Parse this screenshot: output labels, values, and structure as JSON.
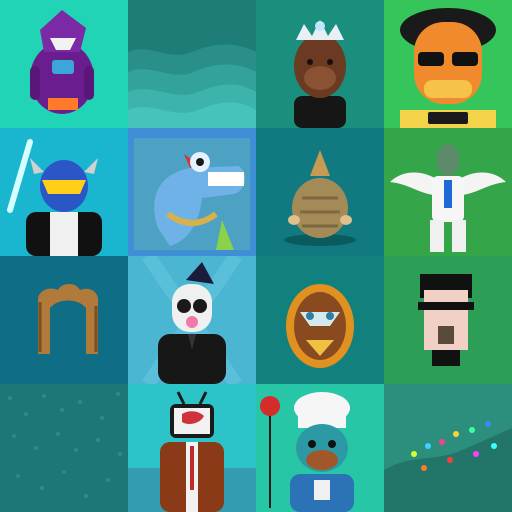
{
  "grid": {
    "columns": 4,
    "rows": 4,
    "tiles": [
      {
        "subject": "purple-shark-monster-icon",
        "bg": "#22d4b6"
      },
      {
        "subject": "teal-waves-icon",
        "bg": "#1f7d78"
      },
      {
        "subject": "ape-with-crown-icon",
        "bg": "#1b8f7d"
      },
      {
        "subject": "orange-cartoon-face-icon",
        "bg": "#35c55a"
      },
      {
        "subject": "blue-robot-samurai-icon",
        "bg": "#1ab6d0"
      },
      {
        "subject": "dinosaur-with-chain-icon",
        "bg": "#3f8fd6"
      },
      {
        "subject": "armadillo-creature-icon",
        "bg": "#107a80"
      },
      {
        "subject": "winged-white-suit-man-icon",
        "bg": "#35a54a"
      },
      {
        "subject": "bronze-arch-gate-icon",
        "bg": "#0f6e86"
      },
      {
        "subject": "skull-wizard-suit-icon",
        "bg": "#4ab6d2"
      },
      {
        "subject": "ornate-mask-medallion-icon",
        "bg": "#12807c"
      },
      {
        "subject": "pixel-sunglasses-man-icon",
        "bg": "#2c9e55"
      },
      {
        "subject": "teal-texture-icon",
        "bg": "#1d7777"
      },
      {
        "subject": "tv-head-businessman-icon",
        "bg": "#2cc4c9"
      },
      {
        "subject": "chef-dog-balloon-icon",
        "bg": "#27c6a6"
      },
      {
        "subject": "colorful-particles-icon",
        "bg": "#2c8f7e"
      }
    ]
  }
}
